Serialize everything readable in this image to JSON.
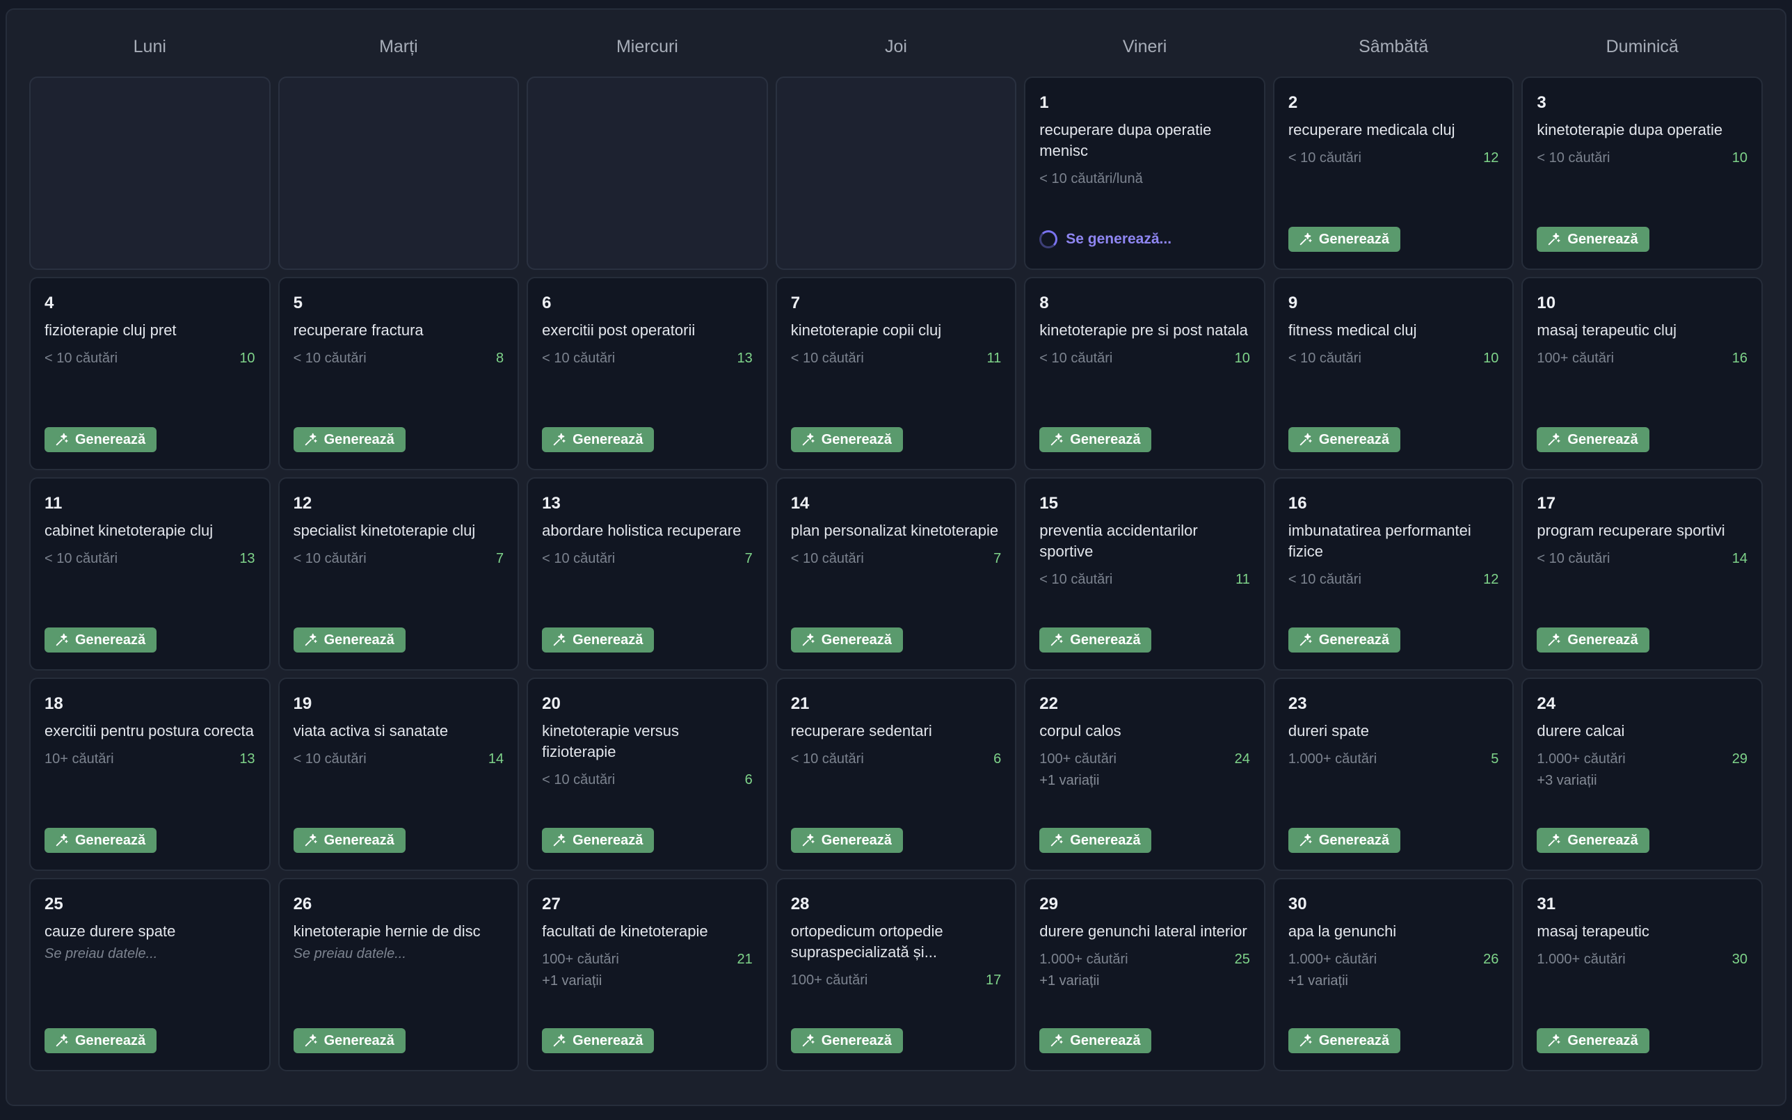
{
  "weekdays": [
    "Luni",
    "Marți",
    "Miercuri",
    "Joi",
    "Vineri",
    "Sâmbătă",
    "Duminică"
  ],
  "leading_empty": 4,
  "generate_label": "Generează",
  "generating_label": "Se generează...",
  "days": [
    {
      "day": "1",
      "keyword": "recuperare dupa operatie menisc",
      "searches": "< 10 căutări/lună",
      "score": "",
      "variations": "",
      "status": "generating"
    },
    {
      "day": "2",
      "keyword": "recuperare medicala cluj",
      "searches": "< 10 căutări",
      "score": "12",
      "variations": ""
    },
    {
      "day": "3",
      "keyword": "kinetoterapie dupa operatie",
      "searches": "< 10 căutări",
      "score": "10",
      "variations": ""
    },
    {
      "day": "4",
      "keyword": "fizioterapie cluj pret",
      "searches": "< 10 căutări",
      "score": "10",
      "variations": ""
    },
    {
      "day": "5",
      "keyword": "recuperare fractura",
      "searches": "< 10 căutări",
      "score": "8",
      "variations": ""
    },
    {
      "day": "6",
      "keyword": "exercitii post operatorii",
      "searches": "< 10 căutări",
      "score": "13",
      "variations": ""
    },
    {
      "day": "7",
      "keyword": "kinetoterapie copii cluj",
      "searches": "< 10 căutări",
      "score": "11",
      "variations": ""
    },
    {
      "day": "8",
      "keyword": "kinetoterapie pre si post natala",
      "searches": "< 10 căutări",
      "score": "10",
      "variations": ""
    },
    {
      "day": "9",
      "keyword": "fitness medical cluj",
      "searches": "< 10 căutări",
      "score": "10",
      "variations": ""
    },
    {
      "day": "10",
      "keyword": "masaj terapeutic cluj",
      "searches": "100+ căutări",
      "score": "16",
      "variations": ""
    },
    {
      "day": "11",
      "keyword": "cabinet kinetoterapie cluj",
      "searches": "< 10 căutări",
      "score": "13",
      "variations": ""
    },
    {
      "day": "12",
      "keyword": "specialist kinetoterapie cluj",
      "searches": "< 10 căutări",
      "score": "7",
      "variations": ""
    },
    {
      "day": "13",
      "keyword": "abordare holistica recuperare",
      "searches": "< 10 căutări",
      "score": "7",
      "variations": ""
    },
    {
      "day": "14",
      "keyword": "plan personalizat kinetoterapie",
      "searches": "< 10 căutări",
      "score": "7",
      "variations": ""
    },
    {
      "day": "15",
      "keyword": "preventia accidentarilor sportive",
      "searches": "< 10 căutări",
      "score": "11",
      "variations": ""
    },
    {
      "day": "16",
      "keyword": "imbunatatirea performantei fizice",
      "searches": "< 10 căutări",
      "score": "12",
      "variations": ""
    },
    {
      "day": "17",
      "keyword": "program recuperare sportivi",
      "searches": "< 10 căutări",
      "score": "14",
      "variations": ""
    },
    {
      "day": "18",
      "keyword": "exercitii pentru postura corecta",
      "searches": "10+ căutări",
      "score": "13",
      "variations": ""
    },
    {
      "day": "19",
      "keyword": "viata activa si sanatate",
      "searches": "< 10 căutări",
      "score": "14",
      "variations": ""
    },
    {
      "day": "20",
      "keyword": "kinetoterapie versus fizioterapie",
      "searches": "< 10 căutări",
      "score": "6",
      "variations": ""
    },
    {
      "day": "21",
      "keyword": "recuperare sedentari",
      "searches": "< 10 căutări",
      "score": "6",
      "variations": ""
    },
    {
      "day": "22",
      "keyword": "corpul calos",
      "searches": "100+ căutări",
      "score": "24",
      "variations": "+1 variații"
    },
    {
      "day": "23",
      "keyword": "dureri spate",
      "searches": "1.000+ căutări",
      "score": "5",
      "variations": ""
    },
    {
      "day": "24",
      "keyword": "durere calcai",
      "searches": "1.000+ căutări",
      "score": "29",
      "variations": "+3 variații"
    },
    {
      "day": "25",
      "keyword": "cauze durere spate",
      "loading": "Se preiau datele...",
      "searches": "",
      "score": "",
      "variations": ""
    },
    {
      "day": "26",
      "keyword": "kinetoterapie hernie de disc",
      "loading": "Se preiau datele...",
      "searches": "",
      "score": "",
      "variations": ""
    },
    {
      "day": "27",
      "keyword": "facultati de kinetoterapie",
      "searches": "100+ căutări",
      "score": "21",
      "variations": "+1 variații"
    },
    {
      "day": "28",
      "keyword": "ortopedicum ortopedie supraspecializată și...",
      "searches": "100+ căutări",
      "score": "17",
      "variations": ""
    },
    {
      "day": "29",
      "keyword": "durere genunchi lateral interior",
      "searches": "1.000+ căutări",
      "score": "25",
      "variations": "+1 variații"
    },
    {
      "day": "30",
      "keyword": "apa la genunchi",
      "searches": "1.000+ căutări",
      "score": "26",
      "variations": "+1 variații"
    },
    {
      "day": "31",
      "keyword": "masaj terapeutic",
      "searches": "1.000+ căutări",
      "score": "30",
      "variations": ""
    }
  ]
}
